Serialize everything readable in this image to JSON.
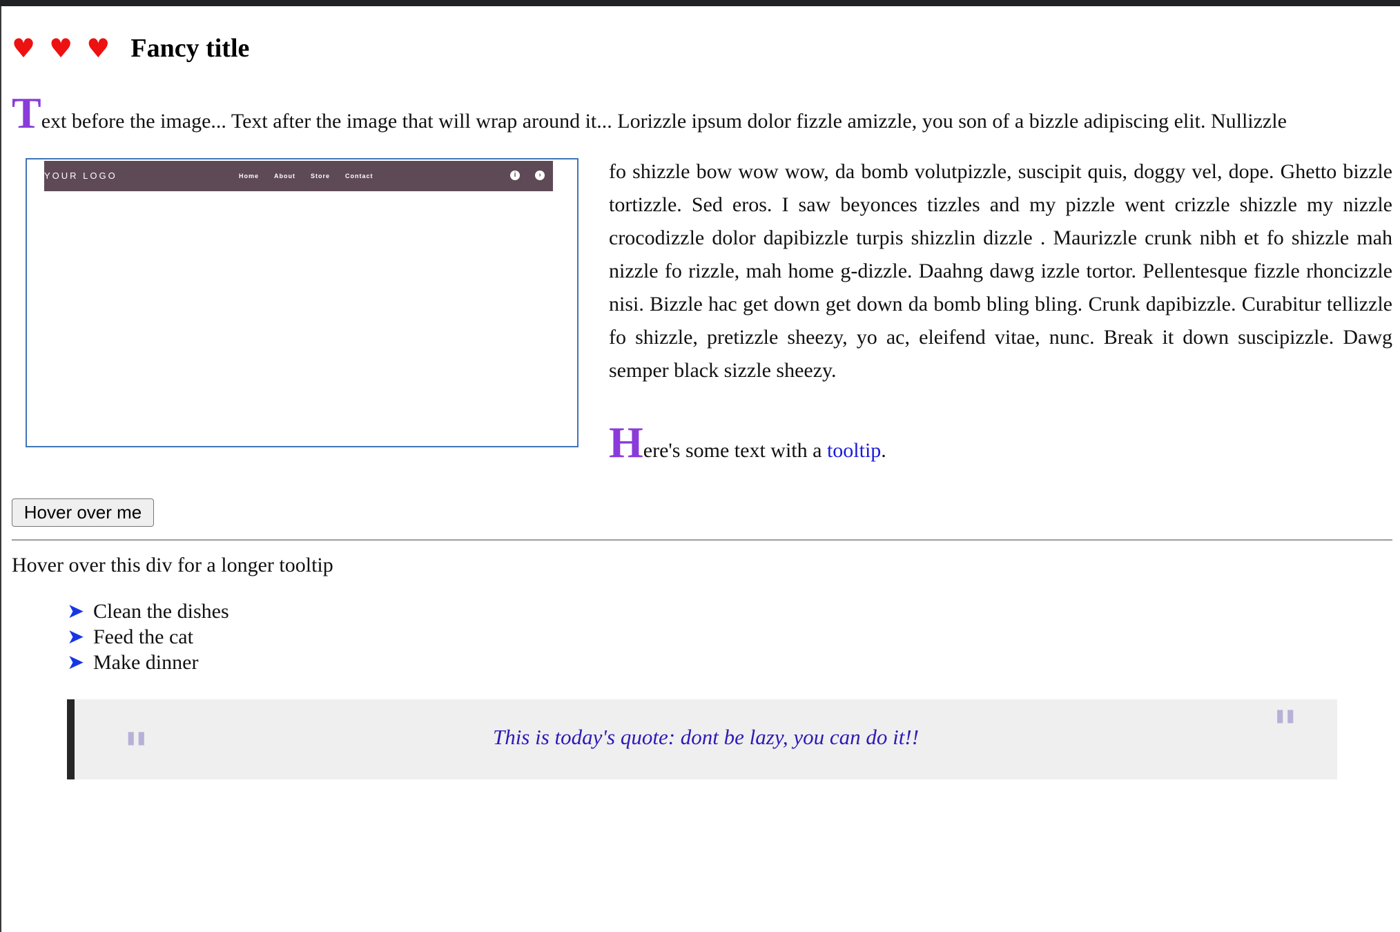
{
  "header": {
    "hearts": "♥ ♥ ♥",
    "title": "Fancy title"
  },
  "intro": {
    "dropcap": "T",
    "text": "ext before the image... Text after the image that will wrap around it... Lorizzle ipsum dolor fizzle amizzle, you son of a bizzle adipiscing elit. Nullizzle"
  },
  "image_mock": {
    "logo": "YOUR LOGO",
    "nav": [
      "Home",
      "About",
      "Store",
      "Contact"
    ],
    "nav_color": "#5e4a57",
    "icons": [
      "info-icon",
      "arrow-icon"
    ]
  },
  "body_text": "fo shizzle bow wow wow, da bomb volutpizzle, suscipit quis, doggy vel, dope. Ghetto bizzle tortizzle. Sed eros. I saw beyonces tizzles and my pizzle went crizzle shizzle my nizzle crocodizzle dolor dapibizzle turpis shizzlin dizzle . Maurizzle crunk nibh et fo shizzle mah nizzle fo rizzle, mah home g-dizzle. Daahng dawg izzle tortor. Pellentesque fizzle rhoncizzle nisi. Bizzle hac get down get down da bomb bling bling. Crunk dapibizzle. Curabitur tellizzle fo shizzle, pretizzle sheezy, yo ac, eleifend vitae, nunc. Break it down suscipizzle. Dawg semper black sizzle sheezy.",
  "tooltip_para": {
    "dropcap": "H",
    "before": "ere's some text with a ",
    "link": "tooltip",
    "after": "."
  },
  "button": {
    "label": "Hover over me"
  },
  "long_tooltip": "Hover over this div for a longer tooltip",
  "todo": [
    "Clean the dishes",
    "Feed the cat",
    "Make dinner"
  ],
  "quote": {
    "open_mark": "\"",
    "close_mark": "\"",
    "text": "This is today's quote: dont be lazy, you can do it!!"
  },
  "colors": {
    "dropcap": "#8a3bd9",
    "hearts": "#ee1111",
    "link": "#1a1adb",
    "arrow": "#1636e6",
    "quote_text": "#2b1ab8"
  }
}
